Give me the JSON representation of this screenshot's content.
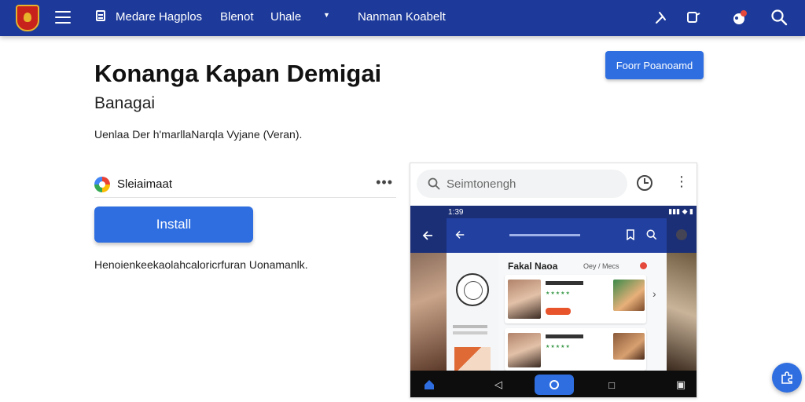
{
  "header": {
    "nav_items": [
      "Medare Hagplos",
      "Blenot",
      "Uhale"
    ],
    "center_title": "Nanman Koabelt",
    "icons": [
      "menu-icon",
      "document-icon",
      "chevron-down-icon",
      "share-icon",
      "open-external-icon",
      "notification-icon",
      "search-icon"
    ],
    "accent_color": "#1d3a9a"
  },
  "main": {
    "title": "Konanga Kapan Demigai",
    "subtitle": "Banagai",
    "description": "Uenlaa Der h'marllaNarqla Vyjane (Veran).",
    "top_button_label": "Foorr Poanoamd",
    "developer": {
      "name": "Sleiaimaat"
    },
    "install_label": "Install",
    "note": "Henoienkeekaolahcaloricrfuran Uonamanlk."
  },
  "preview": {
    "search_placeholder": "Seimtonengh",
    "phone_title": "Fakal",
    "phone_subtitle": "Naoa",
    "phone_tab": "Oey / Mecs",
    "status_time": "1:39"
  },
  "colors": {
    "primary_button": "#2f6ee0",
    "notification_badge": "#e4493b"
  }
}
